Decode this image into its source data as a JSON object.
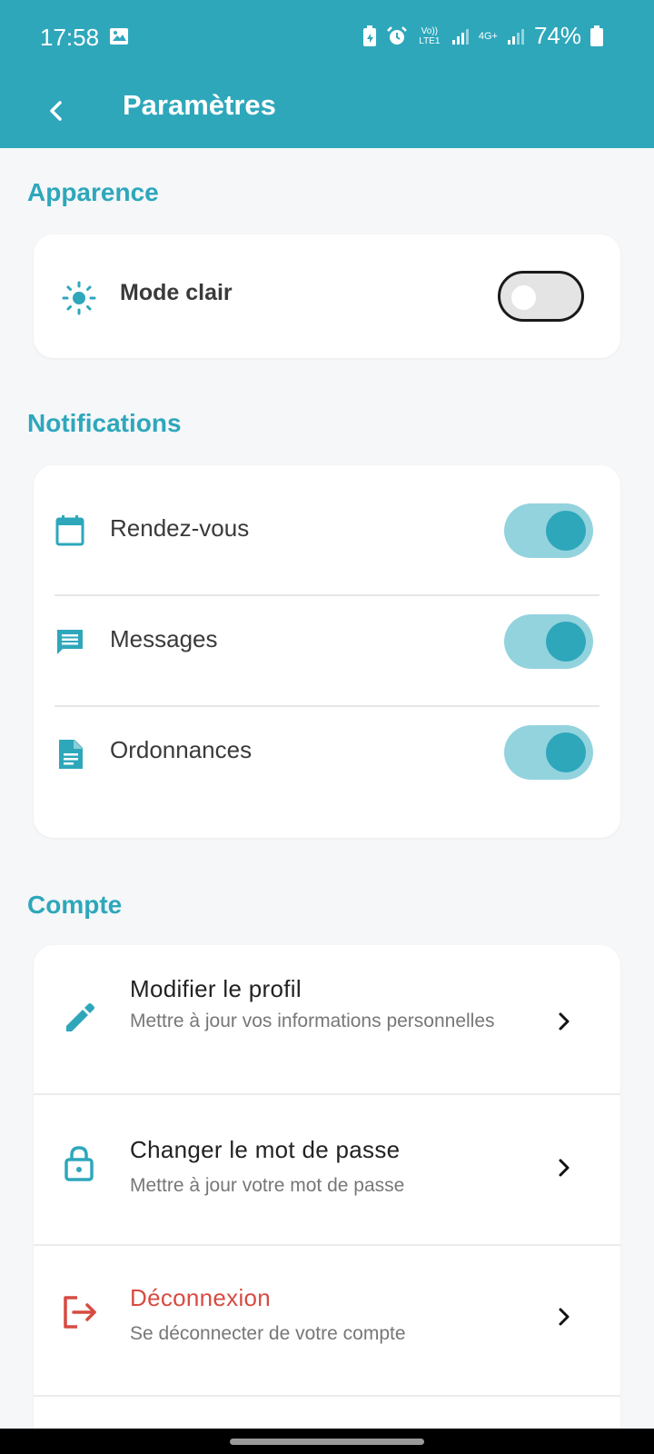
{
  "status_bar": {
    "time": "17:58",
    "battery": "74%",
    "network_labels": [
      "Vo)) LTE1",
      "4G+"
    ]
  },
  "app_bar": {
    "title": "Paramètres",
    "back_icon": "chevron-left-icon"
  },
  "appearance": {
    "section_title": "Apparence",
    "mode_label": "Mode clair",
    "mode_icon": "sun-icon",
    "toggle_on": false
  },
  "notifications": {
    "section_title": "Notifications",
    "items": [
      {
        "label": "Rendez-vous",
        "icon": "calendar-icon",
        "enabled": true
      },
      {
        "label": "Messages",
        "icon": "message-icon",
        "enabled": true
      },
      {
        "label": "Ordonnances",
        "icon": "document-icon",
        "enabled": true
      }
    ]
  },
  "account": {
    "section_title": "Compte",
    "items": [
      {
        "title": "Modifier le profil",
        "subtitle": "Mettre à jour vos informations personnelles",
        "icon": "pencil-icon"
      },
      {
        "title": "Changer le mot de passe",
        "subtitle": "Mettre à jour votre mot de passe",
        "icon": "lock-icon"
      },
      {
        "title": "Déconnexion",
        "subtitle": "Se déconnecter de votre compte",
        "icon": "logout-icon",
        "color": "#d74b42"
      }
    ]
  },
  "colors": {
    "primary": "#2ea7bb",
    "toggle_track_on": "#93d3de",
    "danger": "#d74b42",
    "background": "#f5f7f9"
  }
}
